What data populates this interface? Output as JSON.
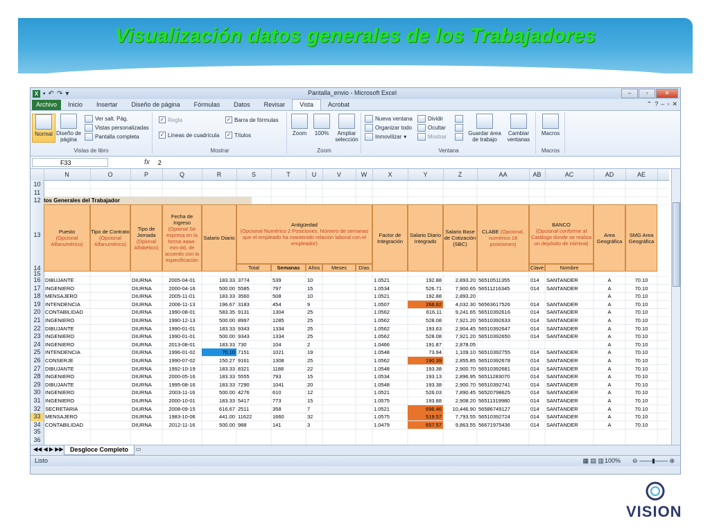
{
  "slide": {
    "title": "Visualización datos generales de los Trabajadores",
    "logo_text": "VISION"
  },
  "window": {
    "title": "Pantalla_envio - Microsoft Excel",
    "brand_color": "#1f7a3a"
  },
  "tabs": [
    "Archivo",
    "Inicio",
    "Insertar",
    "Diseño de página",
    "Fórmulas",
    "Datos",
    "Revisar",
    "Vista",
    "Acrobat"
  ],
  "ribbon": {
    "vistas_libro": {
      "label": "Vistas de libro",
      "normal": "Normal",
      "diseno": "Diseño de página",
      "salto": "Ver salt. Pág.",
      "personalizadas": "Vistas personalizadas",
      "pantalla": "Pantalla completa"
    },
    "mostrar": {
      "label": "Mostrar",
      "regla": "Regla",
      "barra_formulas": "Barra de fórmulas",
      "lineas": "Líneas de cuadrícula",
      "titulos": "Títulos"
    },
    "zoom": {
      "label": "Zoom",
      "zoom": "Zoom",
      "cien": "100%",
      "ampliar": "Ampliar selección"
    },
    "ventana": {
      "label": "Ventana",
      "nueva": "Nueva ventana",
      "organizar": "Organizar todo",
      "inmovilizar": "Inmovilizar",
      "dividir": "Dividir",
      "ocultar": "Ocultar",
      "mostrar": "Mostrar",
      "guardar": "Guardar área de trabajo",
      "cambiar": "Cambiar ventanas"
    },
    "macros": {
      "label": "Macros",
      "macros": "Macros"
    }
  },
  "formula_bar": {
    "name_box": "F33",
    "fx": "fx",
    "value": "2"
  },
  "columns": [
    "N",
    "O",
    "P",
    "Q",
    "R",
    "S",
    "T",
    "U",
    "V",
    "W",
    "X",
    "Y",
    "Z",
    "AA",
    "AB",
    "AC",
    "AD",
    "AE"
  ],
  "section_title": "tos Generales del Trabajador",
  "headers": {
    "puesto": "Puesto",
    "puesto_opt": "(Opcional Alfanumérico)",
    "contrato": "Tipo de Contrato",
    "contrato_opt": "(Opcional Alfanumérico)",
    "jornada": "Tipo de Jornada",
    "jornada_opt": "(Opional Alfabético)",
    "fecha": "Fecha de Ingreso",
    "fecha_opt": "(Opional Se expresa en la forma aaaa-mm-dd, de acuerdo con la especificación",
    "salario": "Salario Diario",
    "antiguedad": "Antigüedad",
    "antiguedad_opt": "(Opcional Numérico 2 Posiciones. Número de semanas que el empleado ha mantenido relación laboral con el empleador)",
    "total": "Total",
    "semanas": "Semanas",
    "anos": "Años",
    "meses": "Meses",
    "dias": "Días",
    "factor": "Factor de Integración",
    "sdi": "Salario Diario Integrado",
    "sbc": "Salario Base de Cotización (SBC)",
    "clabe": "CLABE",
    "clabe_opt": "(Opcional, numérico 18 posiciones)",
    "banco": "BANCO",
    "banco_opt": "(Opcional conforme al Catálogo donde se realiza un depósito de nómina)",
    "clave": "Clave",
    "nombre": "Nombre",
    "area": "Area Geográfica",
    "smg": "SMG Area Geográfica"
  },
  "rows": [
    {
      "n": "16",
      "puesto": "DIBUJANTE",
      "jornada": "DIURNA",
      "fecha": "2005-04-01",
      "salario": "183.33",
      "total": "3774",
      "semanas": "539",
      "anos": "10",
      "factor": "1.0521",
      "sdi": "192.88",
      "sbc": "2,893.20",
      "clabe": "56510511355",
      "clave": "014",
      "banco": "SANTANDER",
      "area": "A",
      "smg": "70.10"
    },
    {
      "n": "17",
      "puesto": "INGENIERO",
      "jornada": "DIURNA",
      "fecha": "2000-04-16",
      "salario": "500.00",
      "total": "5585",
      "semanas": "797",
      "anos": "15",
      "factor": "1.0534",
      "sdi": "526.71",
      "sbc": "7,900.65",
      "clabe": "56511216345",
      "clave": "014",
      "banco": "SANTANDER",
      "area": "A",
      "smg": "70.10"
    },
    {
      "n": "18",
      "puesto": "MENSAJERO",
      "jornada": "DIURNA",
      "fecha": "2005-11-01",
      "salario": "183.33",
      "total": "3560",
      "semanas": "508",
      "anos": "10",
      "factor": "1.0521",
      "sdi": "192.88",
      "sbc": "2,893.20",
      "clabe": "",
      "clave": "",
      "banco": "",
      "area": "A",
      "smg": "70.10",
      "clabe_hl": "yellow"
    },
    {
      "n": "19",
      "puesto": "INTENDENCIA",
      "jornada": "DIURNA",
      "fecha": "2006-11-13",
      "salario": "196.67",
      "total": "3183",
      "semanas": "454",
      "anos": "9",
      "factor": "1.0507",
      "sdi": "268.82",
      "sbc": "4,032.30",
      "clabe": "56563617526",
      "clave": "014",
      "banco": "SANTANDER",
      "area": "A",
      "smg": "70.10",
      "sdi_hl": "orange"
    },
    {
      "n": "20",
      "puesto": "CONTABILIDAD",
      "jornada": "DIURNA",
      "fecha": "1990-08-01",
      "salario": "583.35",
      "total": "9131",
      "semanas": "1304",
      "anos": "25",
      "factor": "1.0562",
      "sdi": "616.11",
      "sbc": "9,241.65",
      "clabe": "56510392616",
      "clave": "014",
      "banco": "SANTANDER",
      "area": "A",
      "smg": "70.10"
    },
    {
      "n": "21",
      "puesto": "INGENIERO",
      "jornada": "DIURNA",
      "fecha": "1990-12-13",
      "salario": "500.00",
      "total": "8997",
      "semanas": "1285",
      "anos": "25",
      "factor": "1.0562",
      "sdi": "528.08",
      "sbc": "7,921.20",
      "clabe": "56510392633",
      "clave": "014",
      "banco": "SANTANDER",
      "area": "A",
      "smg": "70.10"
    },
    {
      "n": "22",
      "puesto": "DIBUJANTE",
      "jornada": "DIURNA",
      "fecha": "1990-01-01",
      "salario": "183.33",
      "total": "9343",
      "semanas": "1334",
      "anos": "25",
      "factor": "1.0562",
      "sdi": "193.63",
      "sbc": "2,904.45",
      "clabe": "56510392647",
      "clave": "014",
      "banco": "SANTANDER",
      "area": "A",
      "smg": "70.10"
    },
    {
      "n": "23",
      "puesto": "INGENIERO",
      "jornada": "DIURNA",
      "fecha": "1990-01-01",
      "salario": "500.00",
      "total": "9343",
      "semanas": "1334",
      "anos": "25",
      "factor": "1.0562",
      "sdi": "528.08",
      "sbc": "7,921.20",
      "clabe": "56510392650",
      "clave": "014",
      "banco": "SANTANDER",
      "area": "A",
      "smg": "70.10"
    },
    {
      "n": "24",
      "puesto": "INGENIERO",
      "jornada": "DIURNA",
      "fecha": "2013-08-01",
      "salario": "183.33",
      "total": "730",
      "semanas": "104",
      "anos": "2",
      "factor": "1.0466",
      "sdi": "191.87",
      "sbc": "2,878.05",
      "clabe": "",
      "clave": "",
      "banco": "",
      "area": "A",
      "smg": "70.10",
      "clabe_hl": "yellow"
    },
    {
      "n": "25",
      "puesto": "INTENDENCIA",
      "jornada": "DIURNA",
      "fecha": "1996-01-02",
      "salario": "70.10",
      "total": "7151",
      "semanas": "1021",
      "anos": "19",
      "factor": "1.0548",
      "sdi": "73.94",
      "sbc": "1,109.10",
      "clabe": "56510392755",
      "clave": "014",
      "banco": "SANTANDER",
      "area": "A",
      "smg": "70.10",
      "salario_hl": "blue"
    },
    {
      "n": "26",
      "puesto": "CONSERJE",
      "jornada": "DIURNA",
      "fecha": "1990-07-02",
      "salario": "150.27",
      "total": "9161",
      "semanas": "1308",
      "anos": "25",
      "factor": "1.0562",
      "sdi": "190.39",
      "sbc": "2,855.85",
      "clabe": "56510392678",
      "clave": "014",
      "banco": "SANTANDER",
      "area": "A",
      "smg": "70.10",
      "sdi_hl": "orange"
    },
    {
      "n": "27",
      "puesto": "DIBUJANTE",
      "jornada": "DIURNA",
      "fecha": "1992-10-19",
      "salario": "183.33",
      "total": "8321",
      "semanas": "1188",
      "anos": "22",
      "factor": "1.0548",
      "sdi": "193.38",
      "sbc": "2,900.70",
      "clabe": "56510392681",
      "clave": "014",
      "banco": "SANTANDER",
      "area": "A",
      "smg": "70.10"
    },
    {
      "n": "28",
      "puesto": "INGENIERO",
      "jornada": "DIURNA",
      "fecha": "2000-05-16",
      "salario": "183.33",
      "total": "5555",
      "semanas": "793",
      "anos": "15",
      "factor": "1.0534",
      "sdi": "193.13",
      "sbc": "2,896.95",
      "clabe": "56511283070",
      "clave": "014",
      "banco": "SANTANDER",
      "area": "A",
      "smg": "70.10"
    },
    {
      "n": "29",
      "puesto": "DIBUJANTE",
      "jornada": "DIURNA",
      "fecha": "1995-08-16",
      "salario": "183.33",
      "total": "7290",
      "semanas": "1041",
      "anos": "20",
      "factor": "1.0548",
      "sdi": "193.38",
      "sbc": "2,900.70",
      "clabe": "56510392741",
      "clave": "014",
      "banco": "SANTANDER",
      "area": "A",
      "smg": "70.10"
    },
    {
      "n": "30",
      "puesto": "INGENIERO",
      "jornada": "DIURNA",
      "fecha": "2003-11-16",
      "salario": "500.00",
      "total": "4276",
      "semanas": "610",
      "anos": "12",
      "factor": "1.0521",
      "sdi": "526.03",
      "sbc": "7,890.45",
      "clabe": "56520798625",
      "clave": "014",
      "banco": "SANTANDER",
      "area": "A",
      "smg": "70.10"
    },
    {
      "n": "31",
      "puesto": "INGENIERO",
      "jornada": "DIURNA",
      "fecha": "2000-10-01",
      "salario": "183.33",
      "total": "5417",
      "semanas": "773",
      "anos": "15",
      "factor": "1.0575",
      "sdi": "193.88",
      "sbc": "2,908.20",
      "clabe": "56511319980",
      "clave": "014",
      "banco": "SANTANDER",
      "area": "A",
      "smg": "70.10"
    },
    {
      "n": "32",
      "puesto": "SECRETARIA",
      "jornada": "DIURNA",
      "fecha": "2008-09-15",
      "salario": "616.67",
      "total": "2511",
      "semanas": "358",
      "anos": "7",
      "factor": "1.0521",
      "sdi": "696.46",
      "sbc": "10,446.90",
      "clabe": "56586749127",
      "clave": "014",
      "banco": "SANTANDER",
      "area": "A",
      "smg": "70.10",
      "sdi_hl": "orange"
    },
    {
      "n": "33",
      "puesto": "MENSAJERO",
      "jornada": "DIURNA",
      "fecha": "1983-10-06",
      "salario": "441.00",
      "total": "11622",
      "semanas": "1660",
      "anos": "32",
      "factor": "1.0575",
      "sdi": "519.57",
      "sbc": "7,793.55",
      "clabe": "56510392724",
      "clave": "014",
      "banco": "SANTANDER",
      "area": "A",
      "smg": "70.10",
      "sdi_hl": "orange"
    },
    {
      "n": "34",
      "puesto": "CONTABILIDAD",
      "jornada": "DIURNA",
      "fecha": "2012-11-16",
      "salario": "500.00",
      "total": "988",
      "semanas": "141",
      "anos": "3",
      "factor": "1.0479",
      "sdi": "657.57",
      "sbc": "9,863.55",
      "clabe": "56671975436",
      "clave": "014",
      "banco": "SANTANDER",
      "area": "A",
      "smg": "70.10",
      "sdi_hl": "orange"
    }
  ],
  "row_numbers_top": [
    "10",
    "11",
    "12",
    "13",
    "14",
    "15"
  ],
  "row_numbers_bottom": [
    "35",
    "36"
  ],
  "sheet_tab": "Desgloce Completo",
  "status": {
    "ready": "Listo",
    "zoom": "100%"
  },
  "colors": {
    "header_fill": "#f9c58c",
    "highlight_orange": "#e8742a",
    "highlight_yellow": "#ffff00",
    "highlight_blue": "#1e90e0",
    "title_green": "#22e21d",
    "banner_blue": "#2e9ad4"
  }
}
